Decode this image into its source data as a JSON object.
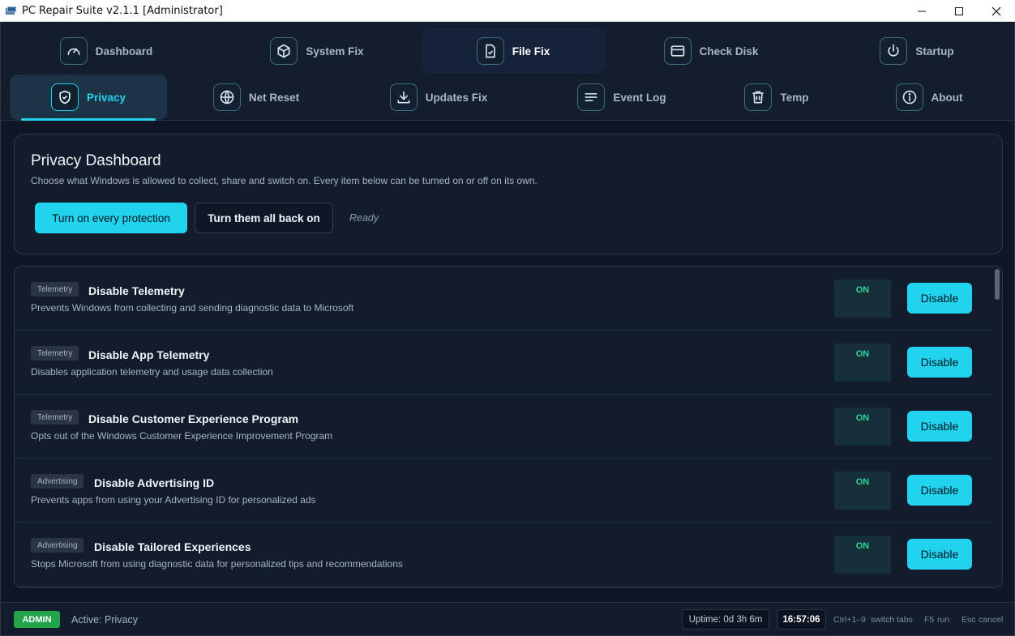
{
  "window": {
    "title": "PC Repair Suite v2.1.1 [Administrator]",
    "controls": [
      "minimize",
      "maximize",
      "close"
    ]
  },
  "nav": {
    "row1": [
      {
        "label": "Dashboard",
        "icon": "gauge-icon"
      },
      {
        "label": "System Fix",
        "icon": "cube-icon"
      },
      {
        "label": "File Fix",
        "icon": "file-check-icon"
      },
      {
        "label": "Check Disk",
        "icon": "disk-icon"
      },
      {
        "label": "Startup",
        "icon": "power-icon"
      }
    ],
    "row2": [
      {
        "label": "Privacy",
        "icon": "shield-check-icon"
      },
      {
        "label": "Net Reset",
        "icon": "globe-icon"
      },
      {
        "label": "Updates Fix",
        "icon": "download-icon"
      },
      {
        "label": "Event Log",
        "icon": "lines-icon"
      },
      {
        "label": "Temp",
        "icon": "trash-icon"
      },
      {
        "label": "About",
        "icon": "info-icon"
      }
    ],
    "active": "Privacy",
    "hovered": "File Fix"
  },
  "hero": {
    "title": "Privacy Dashboard",
    "subtitle": "Choose what Windows is allowed to collect, share and switch on. Every item below can be turned on or off on its own.",
    "primary_button": "Turn on every protection",
    "secondary_button": "Turn them all back on",
    "status": "Ready"
  },
  "items": [
    {
      "tag": "Telemetry",
      "name": "Disable Telemetry",
      "desc": "Prevents Windows from collecting and sending diagnostic data to Microsoft",
      "state": "ON",
      "action": "Disable"
    },
    {
      "tag": "Telemetry",
      "name": "Disable App Telemetry",
      "desc": "Disables application telemetry and usage data collection",
      "state": "ON",
      "action": "Disable"
    },
    {
      "tag": "Telemetry",
      "name": "Disable Customer Experience Program",
      "desc": "Opts out of the Windows Customer Experience Improvement Program",
      "state": "ON",
      "action": "Disable"
    },
    {
      "tag": "Advertising",
      "name": "Disable Advertising ID",
      "desc": "Prevents apps from using your Advertising ID for personalized ads",
      "state": "ON",
      "action": "Disable"
    },
    {
      "tag": "Advertising",
      "name": "Disable Tailored Experiences",
      "desc": "Stops Microsoft from using diagnostic data for personalized tips and recommendations",
      "state": "ON",
      "action": "Disable"
    }
  ],
  "statusbar": {
    "badge": "ADMIN",
    "active_label": "Active: Privacy",
    "uptime": "Uptime: 0d 3h 6m",
    "clock": "16:57:06",
    "hints": [
      {
        "key": "Ctrl+1–9",
        "text": "switch tabs"
      },
      {
        "key": "F5",
        "text": "run"
      },
      {
        "key": "Esc",
        "text": "cancel"
      }
    ]
  },
  "colors": {
    "accent": "#22d3ee",
    "on_state": "#34d399",
    "admin_badge": "#22a34a",
    "background": "#0f1726"
  }
}
